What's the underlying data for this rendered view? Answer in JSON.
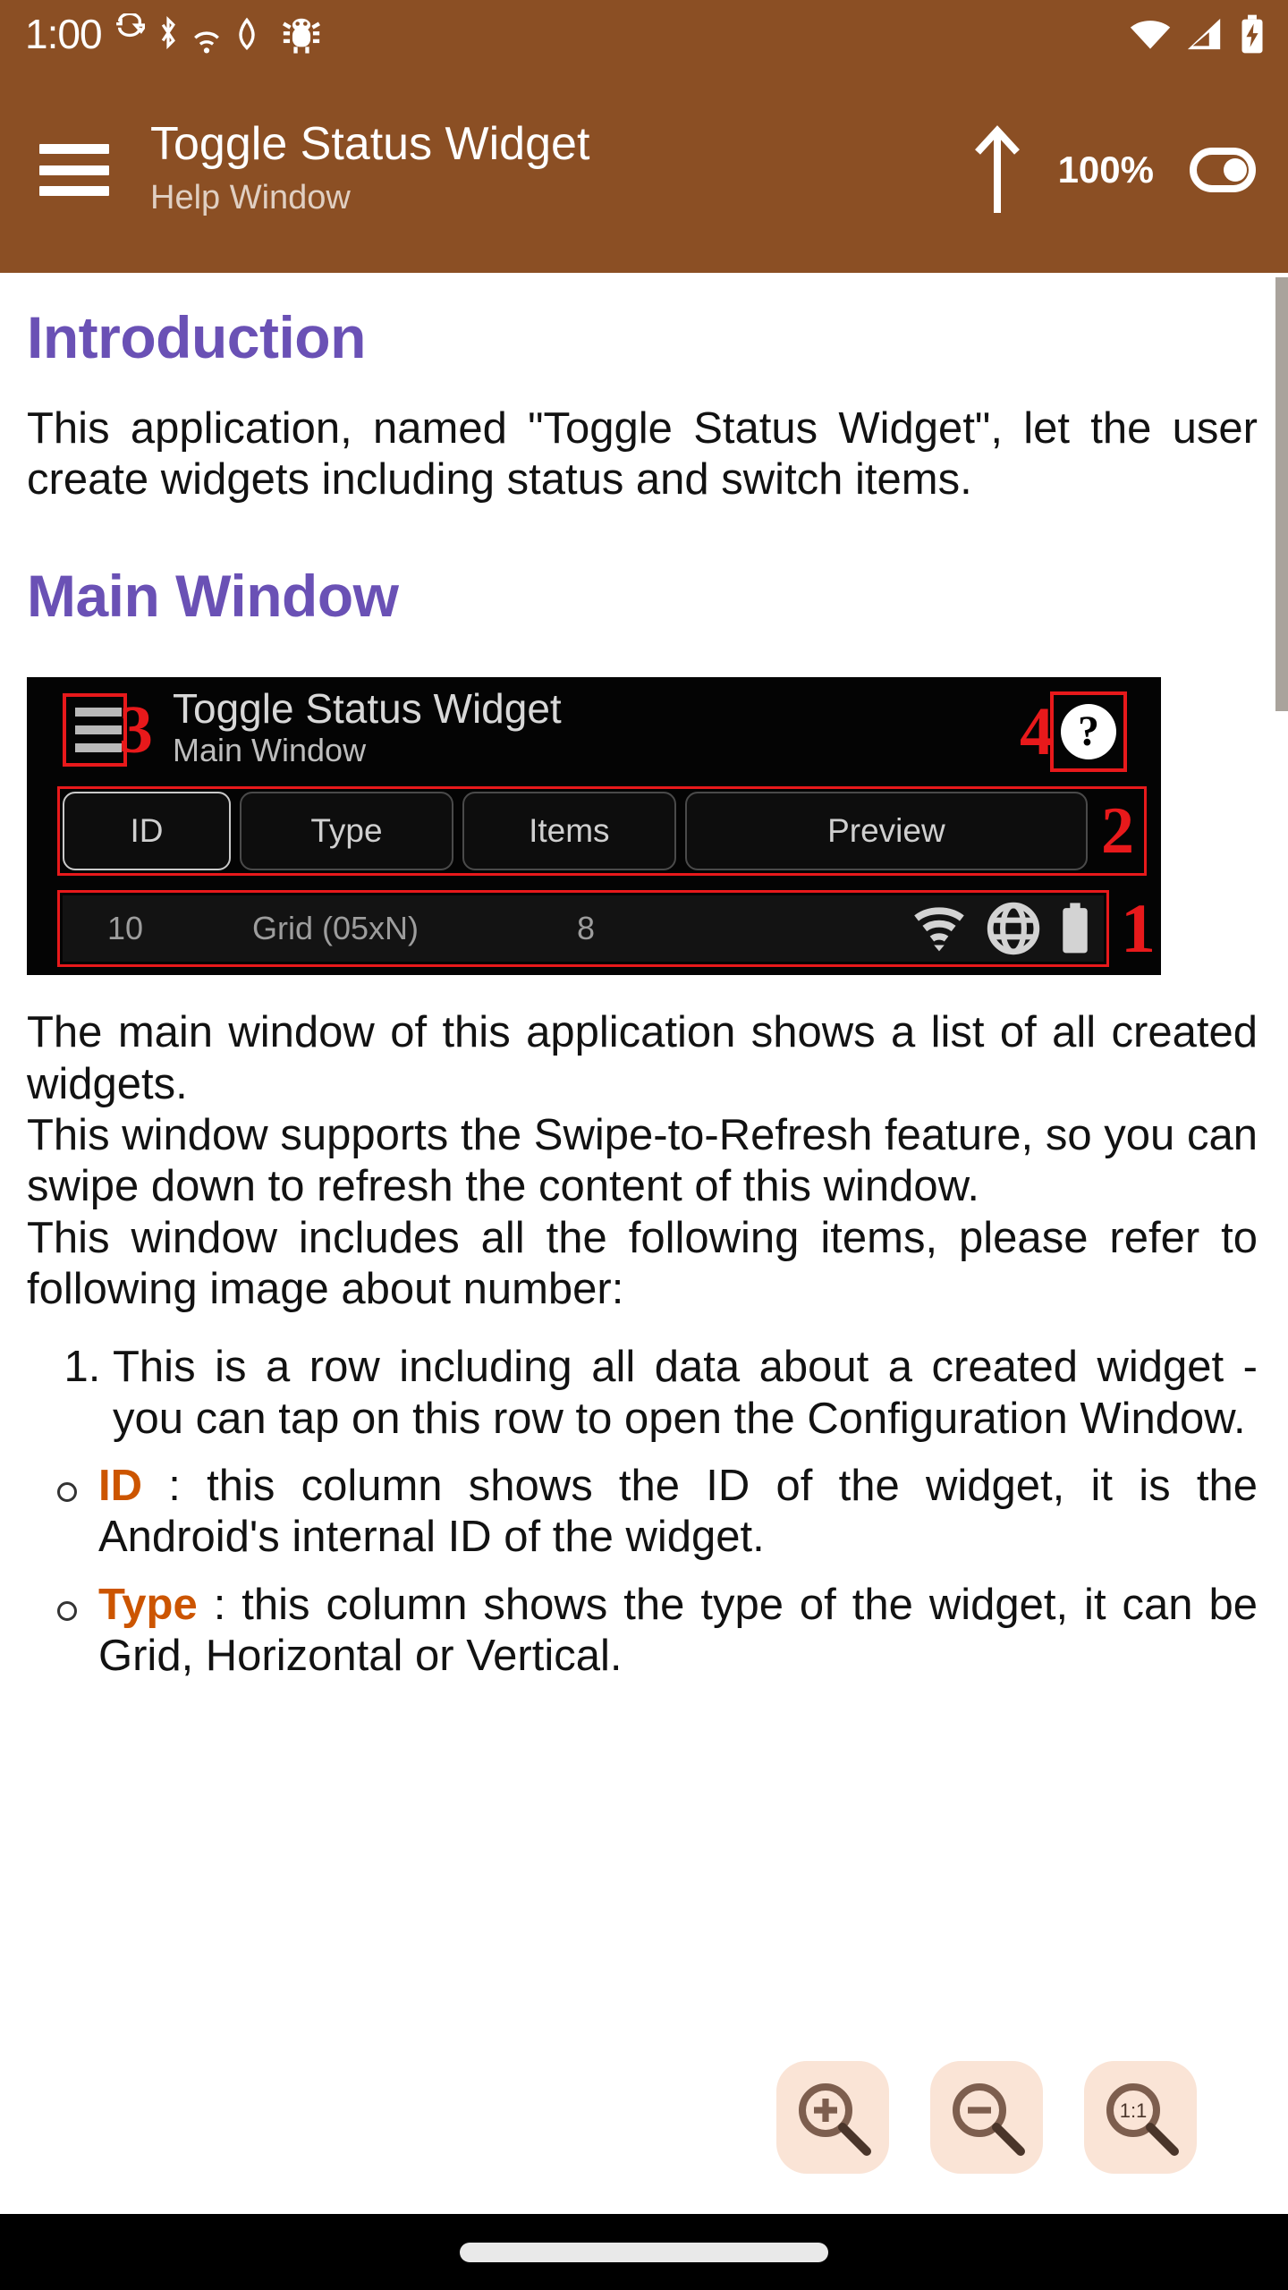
{
  "status_bar": {
    "clock": "1:00",
    "left_icons": [
      "sync-icon",
      "bluetooth-icon",
      "wifi-signal-icon",
      "location-icon",
      "android-debug-icon"
    ],
    "right_icons": [
      "wifi-icon",
      "cellular-signal-icon",
      "battery-charging-icon"
    ]
  },
  "app_bar": {
    "menu_icon": "hamburger-menu-icon",
    "title": "Toggle Status Widget",
    "subtitle": "Help Window",
    "scroll_top_icon": "arrow-up-icon",
    "zoom_level": "100%",
    "theme_toggle_icon": "toggle-switch-icon",
    "background_color": "#8b4f24"
  },
  "content": {
    "heading_color": "#6a51b5",
    "keyword_color": "#cc5500",
    "sections": [
      {
        "heading": "Introduction",
        "paragraphs": [
          "This application, named \"Toggle Status Widget\", let the user create widgets including status and switch items."
        ]
      },
      {
        "heading": "Main Window",
        "paragraphs": [
          "The main window of this application shows a list of all created widgets.",
          "This window supports the Swipe-to-Refresh feature, so you can swipe down to refresh the content of this window.",
          "This window includes all the following items, please refer to following image about number:"
        ]
      }
    ],
    "figure": {
      "name": "main-window-annotated-screenshot",
      "app_title": "Toggle Status Widget",
      "app_subtitle": "Main Window",
      "menu_icon": "hamburger-menu-icon",
      "help_icon": "question-mark-icon",
      "annotation_1": "1",
      "annotation_2": "2",
      "annotation_3": "3",
      "annotation_4": "4",
      "columns": [
        "ID",
        "Type",
        "Items",
        "Preview"
      ],
      "row": {
        "id": "10",
        "type": "Grid (05xN)",
        "items": "8",
        "preview_icons": [
          "wifi-icon",
          "globe-icon",
          "battery-icon"
        ]
      }
    },
    "numbered_list": [
      "This is a row including all data about a created widget - you can tap on this row to open the Configuration Window."
    ],
    "sub_list": [
      {
        "keyword": "ID",
        "text": " : this column shows the ID of the widget, it is the Android's internal ID of the widget."
      },
      {
        "keyword": "Type",
        "text": " : this column shows the type of the widget, it can be Grid, Horizontal or Vertical."
      }
    ]
  },
  "zoom_controls": [
    {
      "name": "zoom-in-button",
      "icon": "magnifier-plus-icon"
    },
    {
      "name": "zoom-out-button",
      "icon": "magnifier-minus-icon"
    },
    {
      "name": "zoom-reset-button",
      "icon": "magnifier-one-to-one-icon"
    }
  ],
  "nav_bar": {
    "gesture_pill": "home-gesture-pill"
  }
}
